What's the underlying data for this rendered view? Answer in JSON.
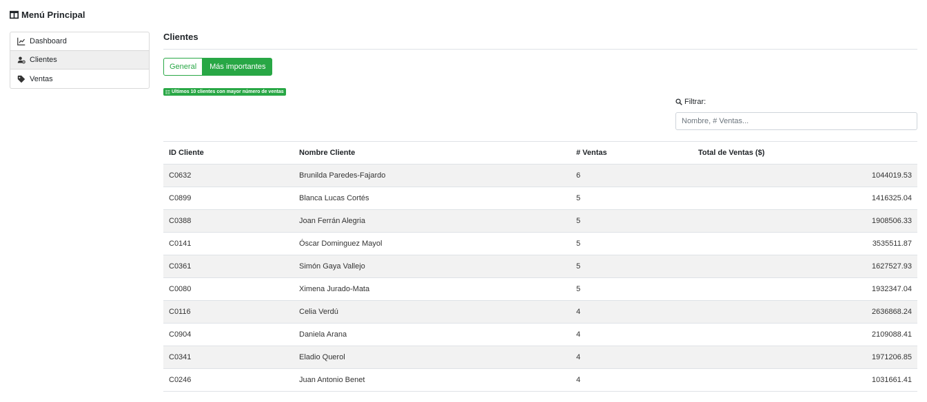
{
  "sidebar": {
    "title": "Menú Principal",
    "title_icon": "columns-icon",
    "items": [
      {
        "label": "Dashboard",
        "icon": "line-chart-icon",
        "active": false
      },
      {
        "label": "Clientes",
        "icon": "user-gear-icon",
        "active": true
      },
      {
        "label": "Ventas",
        "icon": "tag-icon",
        "active": false
      }
    ]
  },
  "main": {
    "title": "Clientes",
    "tabs": [
      {
        "label": "General",
        "active": false
      },
      {
        "label": "Más importantes",
        "active": true
      }
    ],
    "badge": "Ultimos 10 clientes con mayor número de ventas",
    "filter": {
      "label": "Filtrar:",
      "placeholder": "Nombre, # Ventas..."
    },
    "table": {
      "columns": [
        "ID Cliente",
        "Nombre Cliente",
        "# Ventas",
        "Total de Ventas ($)"
      ],
      "rows": [
        [
          "C0632",
          "Brunilda Paredes-Fajardo",
          "6",
          "1044019.53"
        ],
        [
          "C0899",
          "Blanca Lucas Cortés",
          "5",
          "1416325.04"
        ],
        [
          "C0388",
          "Joan Ferrán Alegria",
          "5",
          "1908506.33"
        ],
        [
          "C0141",
          "Óscar Dominguez Mayol",
          "5",
          "3535511.87"
        ],
        [
          "C0361",
          "Simón Gaya Vallejo",
          "5",
          "1627527.93"
        ],
        [
          "C0080",
          "Ximena Jurado-Mata",
          "5",
          "1932347.04"
        ],
        [
          "C0116",
          "Celia Verdú",
          "4",
          "2636868.24"
        ],
        [
          "C0904",
          "Daniela Arana",
          "4",
          "2109088.41"
        ],
        [
          "C0341",
          "Eladio Querol",
          "4",
          "1971206.85"
        ],
        [
          "C0246",
          "Juan Antonio Benet",
          "4",
          "1031661.41"
        ]
      ]
    }
  },
  "colors": {
    "accent": "#28a745",
    "stripe": "#f2f2f2",
    "border": "#dee2e6"
  }
}
